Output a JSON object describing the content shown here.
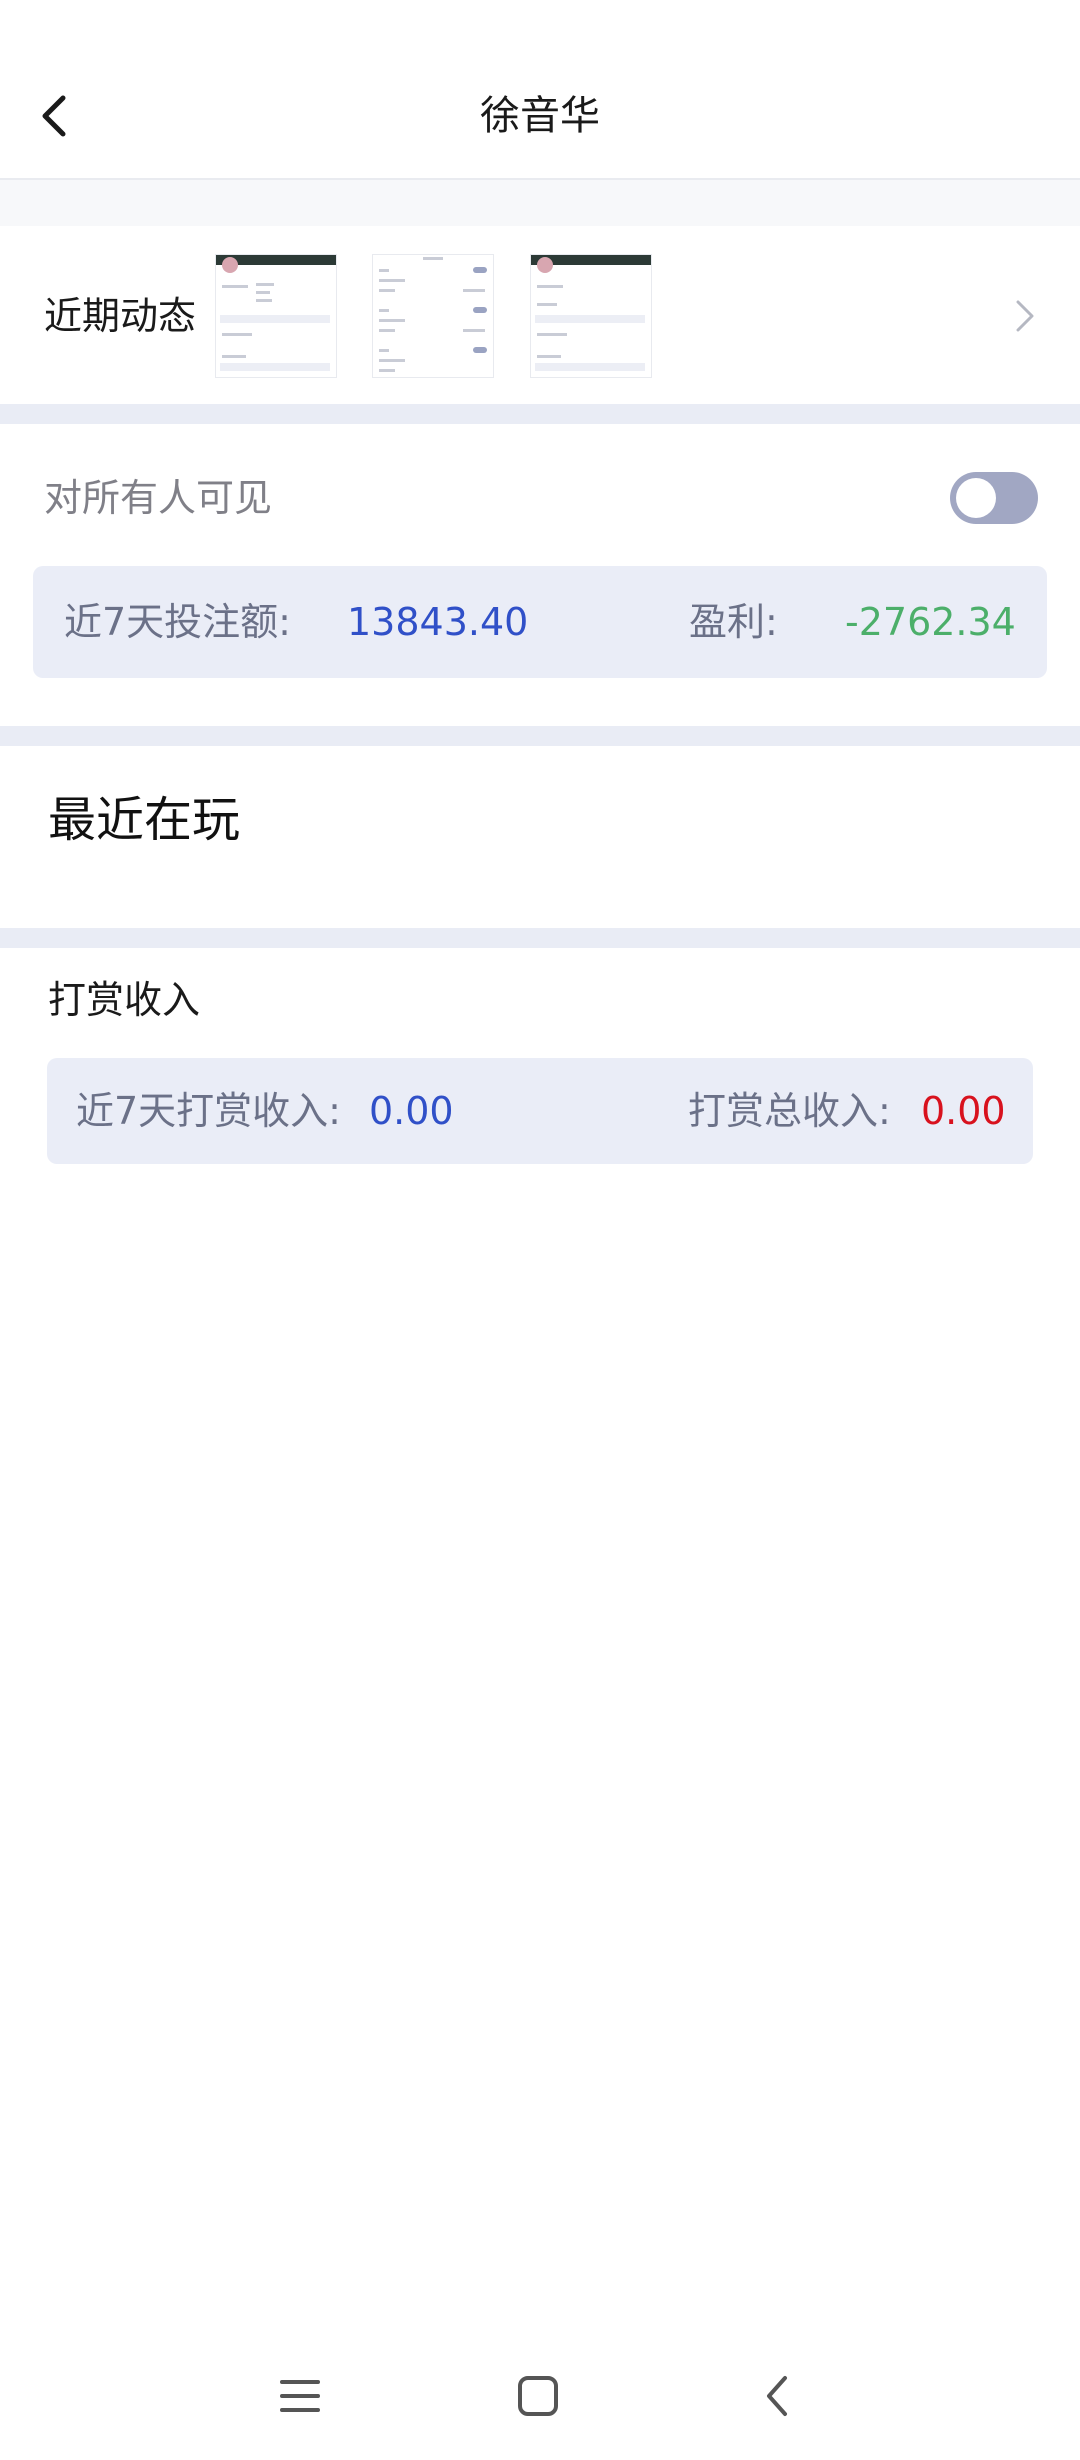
{
  "header": {
    "title": "徐音华",
    "back_icon": "chevron-left-icon"
  },
  "recent_activity": {
    "label": "近期动态",
    "thumbnail_count": 3,
    "arrow_icon": "chevron-right-icon"
  },
  "visibility": {
    "label": "对所有人可见",
    "toggle_on": false
  },
  "betting_stats": {
    "amount_label": "近7天投注额:",
    "amount_value": "13843.40",
    "profit_label": "盈利:",
    "profit_value": "-2762.34"
  },
  "recent_playing": {
    "title": "最近在玩"
  },
  "tip_income": {
    "title": "打赏收入",
    "seven_day_label": "近7天打赏收入:",
    "seven_day_value": "0.00",
    "total_label": "打赏总收入:",
    "total_value": "0.00"
  },
  "bottom_nav": {
    "menu_icon": "menu-icon",
    "home_icon": "home-icon",
    "back_icon": "back-icon"
  },
  "colors": {
    "accent_blue": "#3050c8",
    "profit_green": "#4caf6a",
    "total_red": "#d8121e",
    "panel_bg": "#eaedf7",
    "label_gray": "#6b7188"
  }
}
